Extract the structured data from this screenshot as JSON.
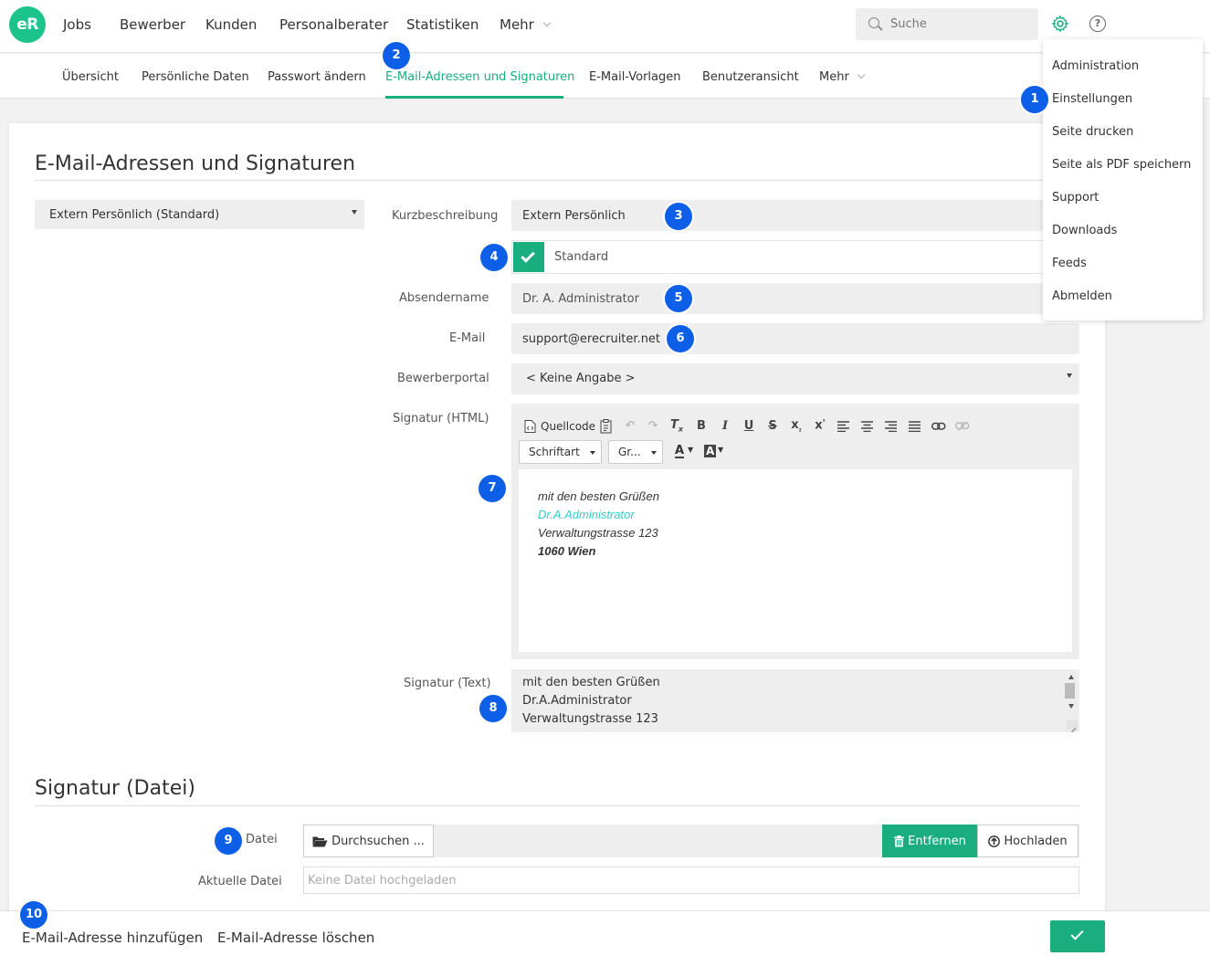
{
  "app": {
    "logo": "eR",
    "accent_color": "#1aae7f",
    "badge_color": "#0d5fe8"
  },
  "topnav": {
    "items": [
      "Jobs",
      "Bewerber",
      "Kunden",
      "Personalberater",
      "Statistiken",
      "Mehr"
    ],
    "search_placeholder": "Suche",
    "icons": [
      "gear-icon",
      "help-icon"
    ]
  },
  "subnav": {
    "items": [
      "Übersicht",
      "Persönliche Daten",
      "Passwort ändern",
      "E-Mail-Adressen und Signaturen",
      "E-Mail-Vorlagen",
      "Benutzeransicht",
      "Mehr"
    ],
    "active": "E-Mail-Adressen und Signaturen"
  },
  "settings_menu": {
    "items": [
      "Administration",
      "Einstellungen",
      "Seite drucken",
      "Seite als PDF speichern",
      "Support",
      "Downloads",
      "Feeds",
      "Abmelden"
    ]
  },
  "main": {
    "title": "E-Mail-Adressen und Signaturen",
    "address_select": "Extern Persönlich (Standard)",
    "form": {
      "kurzbeschreibung_label": "Kurzbeschreibung",
      "kurzbeschreibung_value": "Extern Persönlich",
      "standard_label": "Standard",
      "standard_checked": true,
      "absendername_label": "Absendername",
      "absendername_value": "Dr. A. Administrator",
      "email_label": "E-Mail",
      "email_value": "support@erecruiter.net",
      "bewerberportal_label": "Bewerberportal",
      "bewerberportal_value": "< Keine Angabe >",
      "signatur_html_label": "Signatur (HTML)",
      "signatur_text_label": "Signatur (Text)"
    },
    "editor": {
      "source_label": "Quellcode",
      "font_label": "Schriftart",
      "size_label": "Gr...",
      "toolbar_glyphs": {
        "bold": "B",
        "italic": "I",
        "underline": "U",
        "strike": "S",
        "text_color": "A",
        "bg_color": "A"
      },
      "content": [
        {
          "text": "mit den besten Grüßen",
          "color": "#333333",
          "bold": false
        },
        {
          "text": "Dr.A.Administrator",
          "color": "#33cccc",
          "bold": false
        },
        {
          "text": "Verwaltungstrasse 123",
          "color": "#333333",
          "bold": false
        },
        {
          "text": "1060 Wien",
          "color": "#333333",
          "bold": true
        }
      ]
    },
    "signatur_text": [
      "mit den besten Grüßen",
      "Dr.A.Administrator",
      "Verwaltungstrasse 123"
    ]
  },
  "file_section": {
    "title": "Signatur (Datei)",
    "datei_label": "Datei",
    "browse_button": "Durchsuchen ...",
    "remove_button": "Entfernen",
    "upload_button": "Hochladen",
    "current_label": "Aktuelle Datei",
    "current_placeholder": "Keine Datei hochgeladen"
  },
  "bottombar": {
    "add_label": "E-Mail-Adresse hinzufügen",
    "delete_label": "E-Mail-Adresse löschen"
  },
  "badges": [
    "1",
    "2",
    "3",
    "4",
    "5",
    "6",
    "7",
    "8",
    "9",
    "10"
  ]
}
